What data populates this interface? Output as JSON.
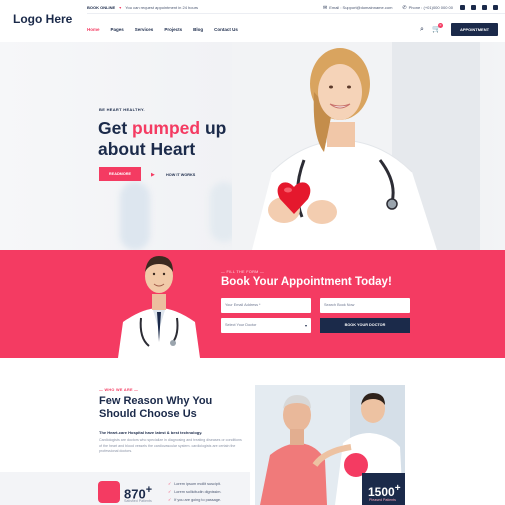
{
  "header": {
    "logo": "Logo Here",
    "topbar": {
      "book_label": "BOOK ONLINE",
      "book_text": "You can request appointment in 24 hours",
      "email": "Email : Support@domainname.com",
      "phone": "Phone : (+01)000 000 00"
    },
    "nav": [
      "Home",
      "Pages",
      "Services",
      "Projects",
      "Blog",
      "Contact Us"
    ],
    "active_nav": "Home",
    "cart_count": "0",
    "appointment_button": "APPOINTMENT"
  },
  "hero": {
    "tagline": "BE HEART HEALTHY.",
    "title_part1": "Get ",
    "title_highlight": "pumped",
    "title_part2": " up",
    "title_line2": "about Heart",
    "read_more": "READMORE",
    "how_it_works": "HOW IT WORKS"
  },
  "appointment": {
    "tag": "— FILL THE FORM —",
    "title": "Book Your Appointment Today!",
    "email_placeholder": "Your Email Address *",
    "search_placeholder": "Search Book Now",
    "select_doctor": "Select Your Doctor",
    "button": "BOOK YOUR DOCTOR"
  },
  "why": {
    "tag": "— WHO WE ARE —",
    "title_line1": "Few Reason Why You",
    "title_line2": "Should Choose Us",
    "subtitle": "The Heart-care Hospital have latest & best technology.",
    "body": "Cardiologists are doctors who specialize in diagnosing and treating diseases or conditions of the heart and blood vessels the cardiovascular system. cardiologists are certain the professional doctors.",
    "stat_value": "870",
    "stat_suffix": "+",
    "stat_label": "Satisfied Patients",
    "checks": [
      "Lorem ipsum mollit suscipit.",
      "Lorem sollicitudin dignissim.",
      "If you are going to passage."
    ],
    "card_value": "1500",
    "card_suffix": "+",
    "card_label": "Pleased Patients"
  },
  "colors": {
    "accent": "#f43b62",
    "navy": "#1b2a4a"
  }
}
